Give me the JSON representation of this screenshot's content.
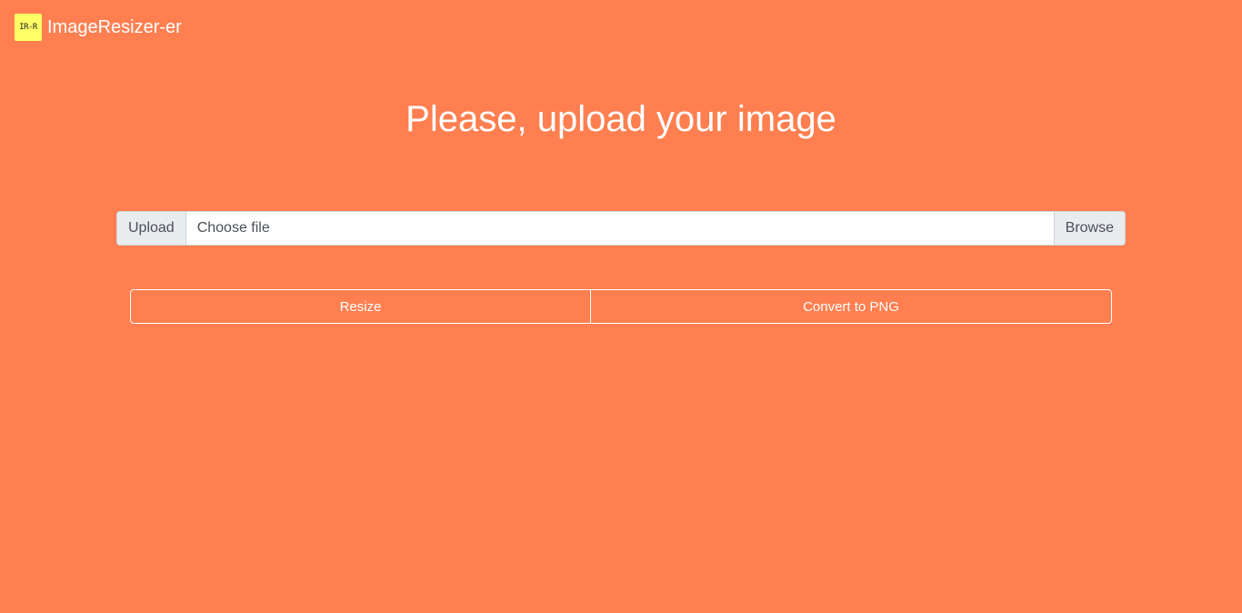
{
  "app": {
    "logo_text": "IR-R",
    "brand": "ImageResizer-er",
    "background_color": "#ff7f50",
    "logo_color": "#ffff66"
  },
  "main": {
    "title": "Please, upload your image",
    "upload": {
      "prepend_label": "Upload",
      "file_placeholder": "Choose file",
      "browse_label": "Browse"
    },
    "actions": {
      "resize_label": "Resize",
      "convert_label": "Convert to PNG"
    }
  }
}
